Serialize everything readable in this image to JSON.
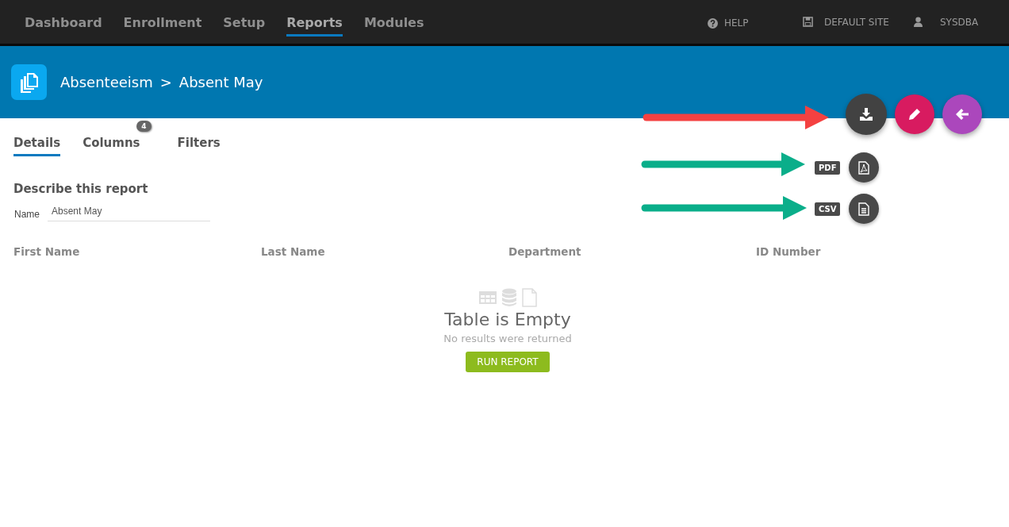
{
  "nav": {
    "items": [
      {
        "label": "Dashboard",
        "selected": false
      },
      {
        "label": "Enrollment",
        "selected": false
      },
      {
        "label": "Setup",
        "selected": false
      },
      {
        "label": "Reports",
        "selected": true
      },
      {
        "label": "Modules",
        "selected": false
      }
    ],
    "help": "HELP",
    "site": "DEFAULT SITE",
    "user": "SYSDBA"
  },
  "header": {
    "breadcrumb": [
      "Absenteeism",
      "Absent May"
    ],
    "separator": ">"
  },
  "tabs": [
    {
      "label": "Details",
      "selected": true
    },
    {
      "label": "Columns",
      "selected": false,
      "badge": "4"
    },
    {
      "label": "Filters",
      "selected": false
    }
  ],
  "section_title": "Describe this report",
  "name_field": {
    "label": "Name",
    "value": "Absent May"
  },
  "table": {
    "columns": [
      "First Name",
      "Last Name",
      "Department",
      "ID Number"
    ]
  },
  "empty_state": {
    "title": "Table is Empty",
    "message": "No results were returned",
    "button": "RUN REPORT"
  },
  "actions": [
    {
      "kind": "download",
      "color": "#424242"
    },
    {
      "kind": "edit",
      "color": "#d81b60"
    },
    {
      "kind": "back",
      "color": "#ab47bc"
    }
  ],
  "export_options": [
    {
      "label": "PDF",
      "kind": "pdf"
    },
    {
      "label": "CSV",
      "kind": "csv"
    }
  ],
  "annotations": [
    {
      "color": "#f44141"
    },
    {
      "color": "#0aae8a"
    },
    {
      "color": "#0aae8a"
    }
  ]
}
